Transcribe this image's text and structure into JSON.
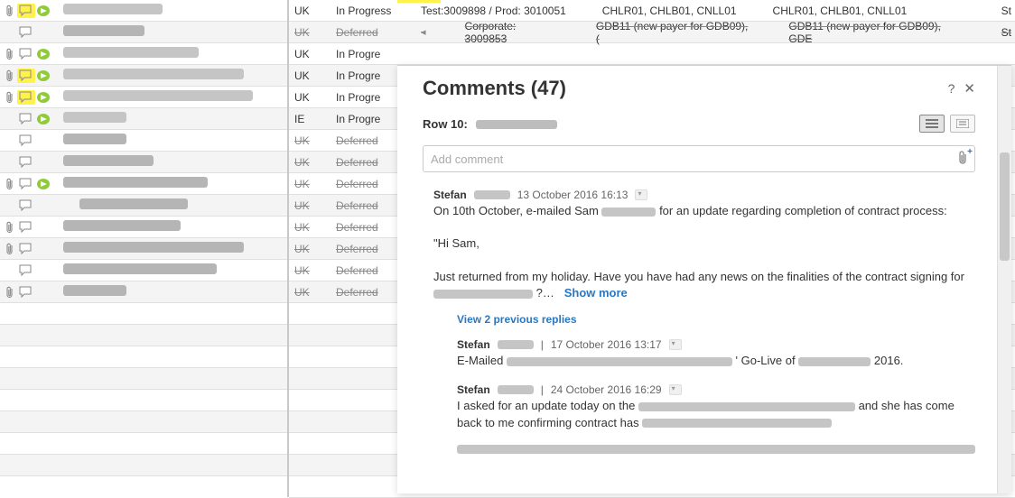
{
  "leftRows": [
    {
      "attach": true,
      "comment": true,
      "flag": true,
      "hl": true,
      "redW": 110,
      "strike": false
    },
    {
      "attach": false,
      "comment": true,
      "flag": false,
      "hl": false,
      "redW": 90,
      "strike": true
    },
    {
      "attach": true,
      "comment": true,
      "flag": true,
      "hl": false,
      "redW": 150,
      "strike": false
    },
    {
      "attach": true,
      "comment": true,
      "flag": true,
      "hl": true,
      "redW": 200,
      "strike": false
    },
    {
      "attach": true,
      "comment": true,
      "flag": true,
      "hl": true,
      "redW": 210,
      "strike": false
    },
    {
      "attach": false,
      "comment": true,
      "flag": true,
      "hl": false,
      "redW": 70,
      "strike": false
    },
    {
      "attach": false,
      "comment": true,
      "flag": false,
      "hl": false,
      "redW": 70,
      "strike": true
    },
    {
      "attach": false,
      "comment": true,
      "flag": false,
      "hl": false,
      "redW": 100,
      "strike": true
    },
    {
      "attach": true,
      "comment": true,
      "flag": true,
      "hl": false,
      "redW": 160,
      "strike": true
    },
    {
      "attach": false,
      "comment": true,
      "flag": false,
      "hl": false,
      "indent": true,
      "redW": 120,
      "strike": true
    },
    {
      "attach": true,
      "comment": true,
      "flag": false,
      "hl": false,
      "redW": 130,
      "strike": true
    },
    {
      "attach": true,
      "comment": true,
      "flag": false,
      "hl": false,
      "redW": 200,
      "strike": true
    },
    {
      "attach": false,
      "comment": true,
      "flag": false,
      "hl": false,
      "redW": 170,
      "strike": true
    },
    {
      "attach": true,
      "comment": true,
      "flag": false,
      "hl": false,
      "redW": 70,
      "strike": true
    }
  ],
  "rightRows": [
    {
      "country": "UK",
      "status": "In Progress",
      "strike": false,
      "mainA": "Test:3009898 / Prod: 3010051",
      "mainB": "CHLR01, CHLB01, CNLL01",
      "mainC": "CHLR01, CHLB01, CNLL01",
      "tail": "St"
    },
    {
      "country": "UK",
      "status": "Deferred",
      "strike": true,
      "arrow": true,
      "mainA": "Corporate: 3009853",
      "mainB": "GDB11 (new payer for GDB09), (",
      "mainC": "GDB11 (new payer for GDB09), GDE",
      "tail": "St"
    },
    {
      "country": "UK",
      "status": "In Progress",
      "strike": false,
      "trunc": true
    },
    {
      "country": "UK",
      "status": "In Progress",
      "strike": false,
      "trunc": true
    },
    {
      "country": "UK",
      "status": "In Progress",
      "strike": false,
      "trunc": true
    },
    {
      "country": "IE",
      "status": "In Progress",
      "strike": false,
      "trunc": true
    },
    {
      "country": "UK",
      "status": "Deferred",
      "strike": true,
      "trunc": true
    },
    {
      "country": "UK",
      "status": "Deferred",
      "strike": true,
      "trunc": true
    },
    {
      "country": "UK",
      "status": "Deferred",
      "strike": true,
      "trunc": true
    },
    {
      "country": "UK",
      "status": "Deferred",
      "strike": true,
      "trunc": true
    },
    {
      "country": "UK",
      "status": "Deferred",
      "strike": true,
      "trunc": true
    },
    {
      "country": "UK",
      "status": "Deferred",
      "strike": true,
      "trunc": true
    },
    {
      "country": "UK",
      "status": "Deferred",
      "strike": true,
      "trunc": true
    },
    {
      "country": "UK",
      "status": "Deferred",
      "strike": true,
      "trunc": true
    }
  ],
  "panel": {
    "title": "Comments (47)",
    "row_prefix": "Row 10:",
    "help": "?",
    "close": "✕",
    "add_placeholder": "Add comment",
    "comments": {
      "c1": {
        "author": "Stefan",
        "date": "13 October 2016 16:13",
        "line1": "On 10th October, e-mailed Sam",
        "line1b": " for an update regarding completion of contract process:",
        "line2": "\"Hi Sam,",
        "line3": "Just returned from my holiday. Have you have had any news on the finalities of the contract signing for",
        "ellipsis": "?…",
        "show_more": "Show more"
      },
      "prev_replies": "View 2 previous replies",
      "r1": {
        "author": "Stefan",
        "sep": "|",
        "date": "17 October 2016 13:17",
        "t1": "E-Mailed",
        "t2": "' Go-Live of",
        "t3": "2016."
      },
      "r2": {
        "author": "Stefan",
        "sep": "|",
        "date": "24 October 2016 16:29",
        "t1": "I asked for an update today on the",
        "t2": "and she has come back to me confirming contract has"
      }
    }
  }
}
